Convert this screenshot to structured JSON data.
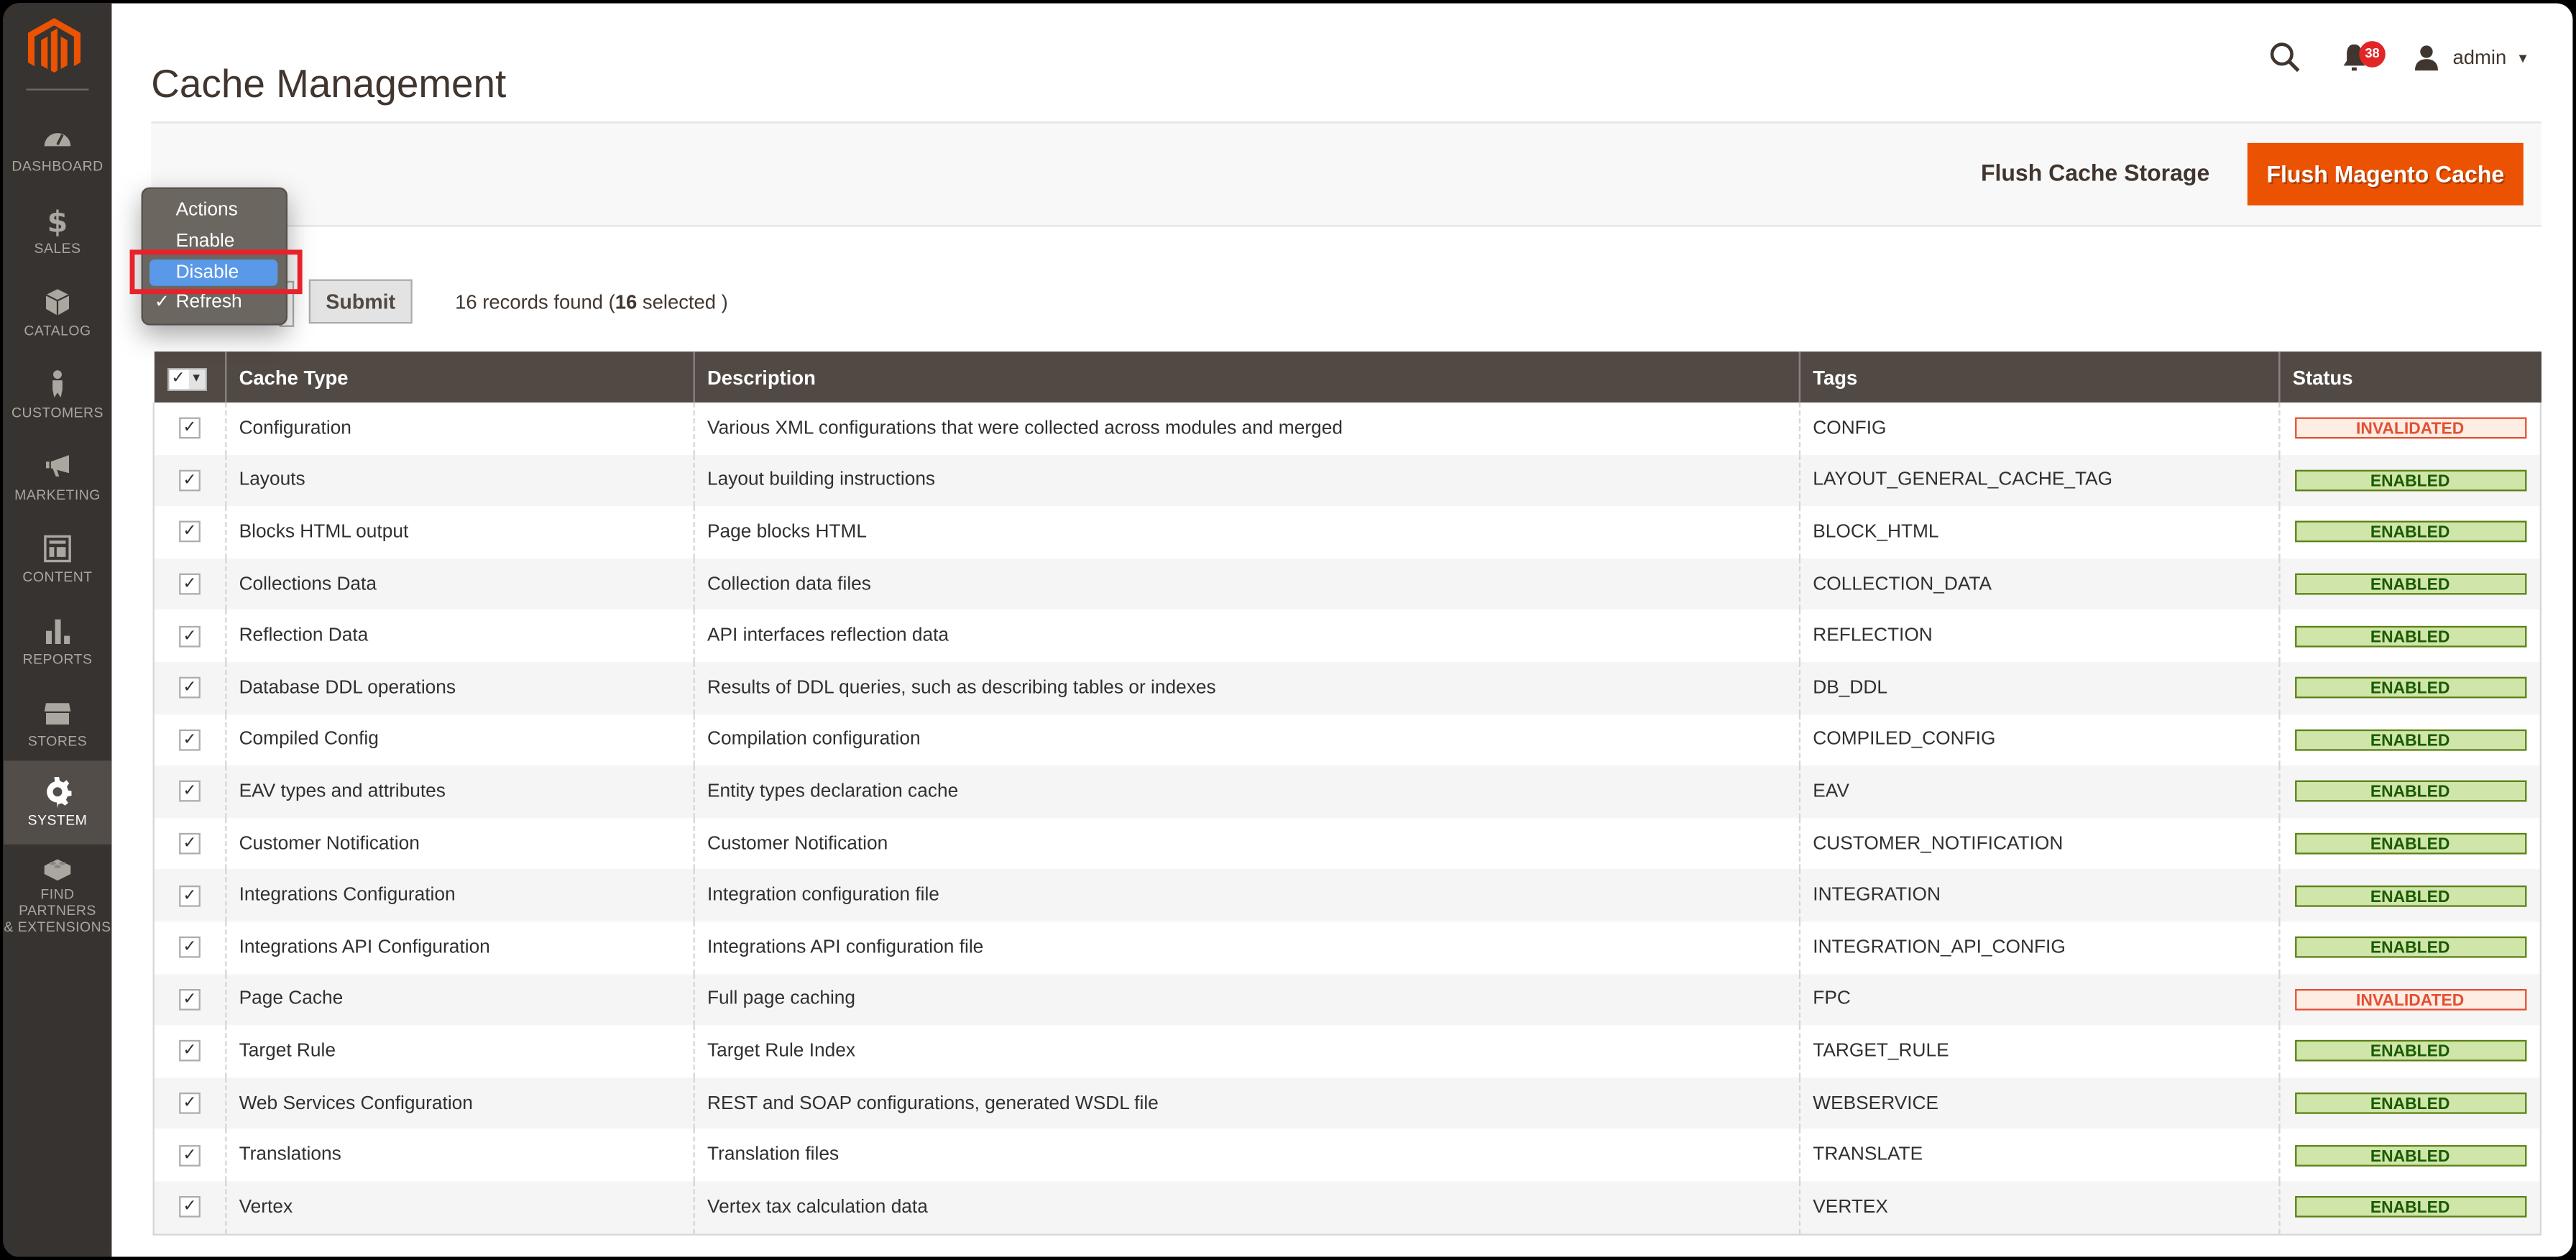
{
  "page": {
    "title": "Cache Management"
  },
  "colors": {
    "accent": "#eb5202",
    "sidebar_bg": "#373330",
    "table_header_bg": "#514943",
    "highlight": "#5a98e8",
    "annotation": "#e8212a"
  },
  "sidebar": {
    "logo": "magento-logo",
    "items": [
      {
        "label": "DASHBOARD",
        "icon": "dashboard-icon",
        "active": false
      },
      {
        "label": "SALES",
        "icon": "dollar-icon",
        "active": false
      },
      {
        "label": "CATALOG",
        "icon": "box-icon",
        "active": false
      },
      {
        "label": "CUSTOMERS",
        "icon": "person-icon",
        "active": false
      },
      {
        "label": "MARKETING",
        "icon": "megaphone-icon",
        "active": false
      },
      {
        "label": "CONTENT",
        "icon": "layout-icon",
        "active": false
      },
      {
        "label": "REPORTS",
        "icon": "bar-chart-icon",
        "active": false
      },
      {
        "label": "STORES",
        "icon": "storefront-icon",
        "active": false
      },
      {
        "label": "SYSTEM",
        "icon": "gear-icon",
        "active": true
      },
      {
        "label": "FIND PARTNERS & EXTENSIONS",
        "label_line1": "FIND PARTNERS",
        "label_line2": "& EXTENSIONS",
        "icon": "lego-brick-icon",
        "active": false
      }
    ]
  },
  "header": {
    "notifications_count": "38",
    "user_name": "admin"
  },
  "actions_bar": {
    "flush_cache_storage": "Flush Cache Storage",
    "flush_magento_cache": "Flush Magento Cache"
  },
  "mass_action": {
    "menu_items": [
      {
        "label": "Actions",
        "checked": false,
        "highlighted": false
      },
      {
        "label": "Enable",
        "checked": false,
        "highlighted": false
      },
      {
        "label": "Disable",
        "checked": false,
        "highlighted": true
      },
      {
        "label": "Refresh",
        "checked": true,
        "highlighted": false
      }
    ],
    "check_mark": "✓",
    "submit_label": "Submit",
    "records_prefix": "16 records found (",
    "selected_count": "16",
    "records_suffix": " selected )"
  },
  "grid": {
    "columns": [
      "Cache Type",
      "Description",
      "Tags",
      "Status"
    ],
    "rows": [
      {
        "checked": true,
        "type": "Configuration",
        "description": "Various XML configurations that were collected across modules and merged",
        "tags": "CONFIG",
        "status": "INVALIDATED"
      },
      {
        "checked": true,
        "type": "Layouts",
        "description": "Layout building instructions",
        "tags": "LAYOUT_GENERAL_CACHE_TAG",
        "status": "ENABLED"
      },
      {
        "checked": true,
        "type": "Blocks HTML output",
        "description": "Page blocks HTML",
        "tags": "BLOCK_HTML",
        "status": "ENABLED"
      },
      {
        "checked": true,
        "type": "Collections Data",
        "description": "Collection data files",
        "tags": "COLLECTION_DATA",
        "status": "ENABLED"
      },
      {
        "checked": true,
        "type": "Reflection Data",
        "description": "API interfaces reflection data",
        "tags": "REFLECTION",
        "status": "ENABLED"
      },
      {
        "checked": true,
        "type": "Database DDL operations",
        "description": "Results of DDL queries, such as describing tables or indexes",
        "tags": "DB_DDL",
        "status": "ENABLED"
      },
      {
        "checked": true,
        "type": "Compiled Config",
        "description": "Compilation configuration",
        "tags": "COMPILED_CONFIG",
        "status": "ENABLED"
      },
      {
        "checked": true,
        "type": "EAV types and attributes",
        "description": "Entity types declaration cache",
        "tags": "EAV",
        "status": "ENABLED"
      },
      {
        "checked": true,
        "type": "Customer Notification",
        "description": "Customer Notification",
        "tags": "CUSTOMER_NOTIFICATION",
        "status": "ENABLED"
      },
      {
        "checked": true,
        "type": "Integrations Configuration",
        "description": "Integration configuration file",
        "tags": "INTEGRATION",
        "status": "ENABLED"
      },
      {
        "checked": true,
        "type": "Integrations API Configuration",
        "description": "Integrations API configuration file",
        "tags": "INTEGRATION_API_CONFIG",
        "status": "ENABLED"
      },
      {
        "checked": true,
        "type": "Page Cache",
        "description": "Full page caching",
        "tags": "FPC",
        "status": "INVALIDATED"
      },
      {
        "checked": true,
        "type": "Target Rule",
        "description": "Target Rule Index",
        "tags": "TARGET_RULE",
        "status": "ENABLED"
      },
      {
        "checked": true,
        "type": "Web Services Configuration",
        "description": "REST and SOAP configurations, generated WSDL file",
        "tags": "WEBSERVICE",
        "status": "ENABLED"
      },
      {
        "checked": true,
        "type": "Translations",
        "description": "Translation files",
        "tags": "TRANSLATE",
        "status": "ENABLED"
      },
      {
        "checked": true,
        "type": "Vertex",
        "description": "Vertex tax calculation data",
        "tags": "VERTEX",
        "status": "ENABLED"
      }
    ]
  }
}
